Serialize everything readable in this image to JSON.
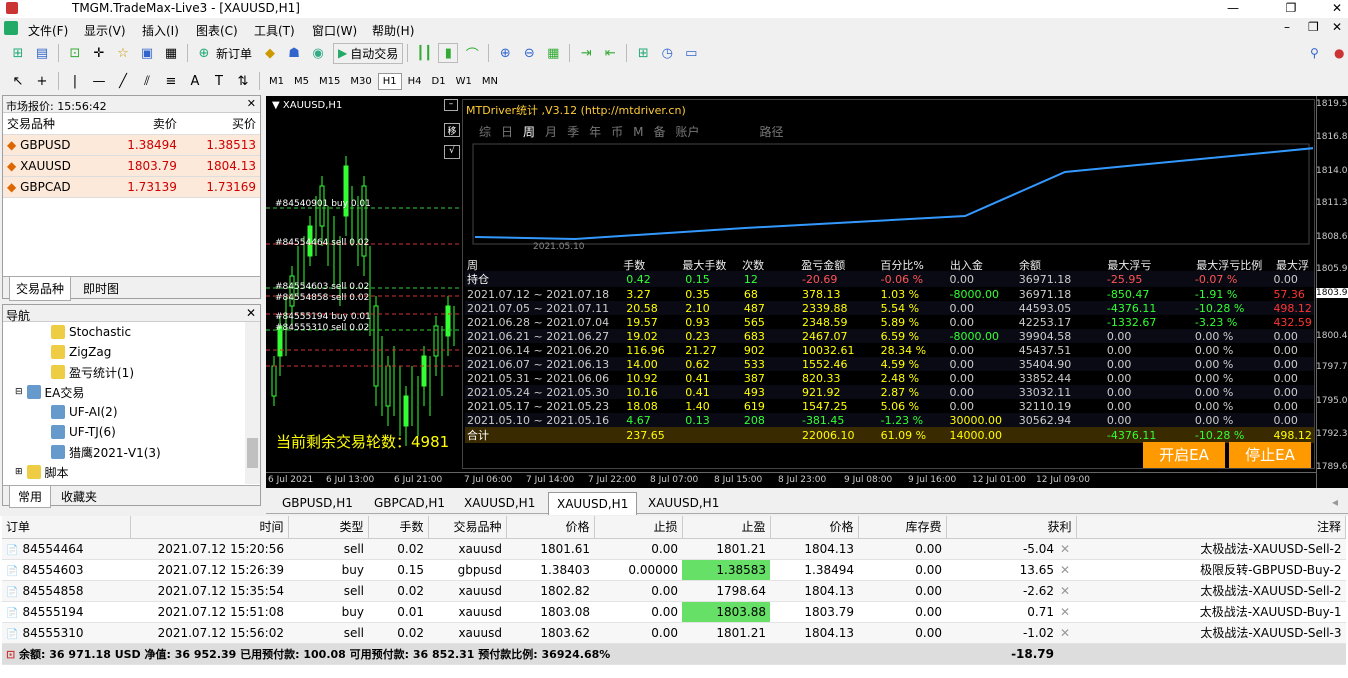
{
  "window": {
    "title": "TMGM.TradeMax-Live3 - [XAUUSD,H1]"
  },
  "menu": [
    "文件(F)",
    "显示(V)",
    "插入(I)",
    "图表(C)",
    "工具(T)",
    "窗口(W)",
    "帮助(H)"
  ],
  "toolbar": {
    "new_order": "新订单",
    "auto_trade": "自动交易",
    "timeframes": [
      "M1",
      "M5",
      "M15",
      "M30",
      "H1",
      "H4",
      "D1",
      "W1",
      "MN"
    ]
  },
  "market_watch": {
    "title": "市场报价: 15:56:42",
    "headers": [
      "交易品种",
      "卖价",
      "买价"
    ],
    "rows": [
      {
        "symbol": "GBPUSD",
        "bid": "1.38494",
        "ask": "1.38513"
      },
      {
        "symbol": "XAUUSD",
        "bid": "1803.79",
        "ask": "1804.13"
      },
      {
        "symbol": "GBPCAD",
        "bid": "1.73139",
        "ask": "1.73169"
      }
    ],
    "tabs": [
      "交易品种",
      "即时图"
    ]
  },
  "navigator": {
    "title": "导航",
    "items": [
      "Stochastic",
      "ZigZag",
      "盈亏统计(1)",
      "EA交易",
      "UF-AI(2)",
      "UF-TJ(6)",
      "猎鹰2021-V1(3)",
      "脚本"
    ],
    "tabs": [
      "常用",
      "收藏夹"
    ]
  },
  "chart": {
    "symbol": "XAUUSD,H1",
    "remaining": "当前剩余交易轮数：4981",
    "order_labels": [
      "#84540901 buy 0.01",
      "#84554464 sell 0.02",
      "#84554603 sell 0.02",
      "#84554858 sell 0.02",
      "#84555194 buy 0.01",
      "#84555310 sell 0.02"
    ],
    "prices": [
      "1819.50",
      "1816.80",
      "1814.00",
      "1811.30",
      "1808.60",
      "1805.90",
      "1803.9",
      "1800.40",
      "1797.70",
      "1795.00",
      "1792.30",
      "1789.60"
    ],
    "times": [
      "6 Jul 2021",
      "6 Jul 13:00",
      "6 Jul 21:00",
      "7 Jul 06:00",
      "7 Jul 14:00",
      "7 Jul 22:00",
      "8 Jul 07:00",
      "8 Jul 15:00",
      "8 Jul 23:00",
      "9 Jul 08:00",
      "9 Jul 16:00",
      "12 Jul 01:00",
      "12 Jul 09:00"
    ]
  },
  "stat": {
    "title": "MTDriver统计 ,V3.12 (http://mtdriver.cn)",
    "tabs": [
      "综",
      "日",
      "周",
      "月",
      "季",
      "年",
      "币",
      "M",
      "备",
      "账户",
      "路径"
    ],
    "active_tab": "周",
    "curve_date": "2021.05.10",
    "headers": [
      "周",
      "手数",
      "最大手数",
      "次数",
      "盈亏金额",
      "百分比%",
      "出入金",
      "余额",
      "最大浮亏",
      "最大浮亏比例",
      "最大浮"
    ],
    "rows": [
      [
        "持仓",
        "0.42",
        "0.15",
        "12",
        "-20.69",
        "-0.06 %",
        "0.00",
        "36971.18",
        "-25.95",
        "-0.07 %",
        "0.00"
      ],
      [
        "2021.07.12 ~ 2021.07.18",
        "3.27",
        "0.35",
        "68",
        "378.13",
        "1.03 %",
        "-8000.00",
        "36971.18",
        "-850.47",
        "-1.91 %",
        "57.36"
      ],
      [
        "2021.07.05 ~ 2021.07.11",
        "20.58",
        "2.10",
        "487",
        "2339.88",
        "5.54 %",
        "0.00",
        "44593.05",
        "-4376.11",
        "-10.28 %",
        "498.12"
      ],
      [
        "2021.06.28 ~ 2021.07.04",
        "19.57",
        "0.93",
        "565",
        "2348.59",
        "5.89 %",
        "0.00",
        "42253.17",
        "-1332.67",
        "-3.23 %",
        "432.59"
      ],
      [
        "2021.06.21 ~ 2021.06.27",
        "19.02",
        "0.23",
        "683",
        "2467.07",
        "6.59 %",
        "-8000.00",
        "39904.58",
        "0.00",
        "0.00 %",
        "0.00"
      ],
      [
        "2021.06.14 ~ 2021.06.20",
        "116.96",
        "21.27",
        "902",
        "10032.61",
        "28.34 %",
        "0.00",
        "45437.51",
        "0.00",
        "0.00 %",
        "0.00"
      ],
      [
        "2021.06.07 ~ 2021.06.13",
        "14.00",
        "0.62",
        "533",
        "1552.46",
        "4.59 %",
        "0.00",
        "35404.90",
        "0.00",
        "0.00 %",
        "0.00"
      ],
      [
        "2021.05.31 ~ 2021.06.06",
        "10.92",
        "0.41",
        "387",
        "820.33",
        "2.48 %",
        "0.00",
        "33852.44",
        "0.00",
        "0.00 %",
        "0.00"
      ],
      [
        "2021.05.24 ~ 2021.05.30",
        "10.16",
        "0.41",
        "493",
        "921.92",
        "2.87 %",
        "0.00",
        "33032.11",
        "0.00",
        "0.00 %",
        "0.00"
      ],
      [
        "2021.05.17 ~ 2021.05.23",
        "18.08",
        "1.40",
        "619",
        "1547.25",
        "5.06 %",
        "0.00",
        "32110.19",
        "0.00",
        "0.00 %",
        "0.00"
      ],
      [
        "2021.05.10 ~ 2021.05.16",
        "4.67",
        "0.13",
        "208",
        "-381.45",
        "-1.23 %",
        "30000.00",
        "30562.94",
        "0.00",
        "0.00 %",
        "0.00"
      ],
      [
        "合计",
        "237.65",
        "",
        "",
        "22006.10",
        "61.09 %",
        "14000.00",
        "",
        "-4376.11",
        "-10.28 %",
        "498.12"
      ]
    ],
    "btn_start": "开启EA",
    "btn_stop": "停止EA"
  },
  "chart_tabs": [
    "GBPUSD,H1",
    "GBPCAD,H1",
    "XAUUSD,H1",
    "XAUUSD,H1",
    "XAUUSD,H1"
  ],
  "orders": {
    "headers": [
      "订单",
      "时间",
      "类型",
      "手数",
      "交易品种",
      "价格",
      "止损",
      "止盈",
      "价格",
      "库存费",
      "获利",
      "注释"
    ],
    "rows": [
      [
        "84554464",
        "2021.07.12 15:20:56",
        "sell",
        "0.02",
        "xauusd",
        "1801.61",
        "0.00",
        "1801.21",
        "1804.13",
        "0.00",
        "-5.04",
        "太极战法-XAUUSD-Sell-2"
      ],
      [
        "84554603",
        "2021.07.12 15:26:39",
        "buy",
        "0.15",
        "gbpusd",
        "1.38403",
        "0.00000",
        "1.38583",
        "1.38494",
        "0.00",
        "13.65",
        "极限反转-GBPUSD-Buy-2"
      ],
      [
        "84554858",
        "2021.07.12 15:35:54",
        "sell",
        "0.02",
        "xauusd",
        "1802.82",
        "0.00",
        "1798.64",
        "1804.13",
        "0.00",
        "-2.62",
        "太极战法-XAUUSD-Sell-2"
      ],
      [
        "84555194",
        "2021.07.12 15:51:08",
        "buy",
        "0.01",
        "xauusd",
        "1803.08",
        "0.00",
        "1803.88",
        "1803.79",
        "0.00",
        "0.71",
        "太极战法-XAUUSD-Buy-1"
      ],
      [
        "84555310",
        "2021.07.12 15:56:02",
        "sell",
        "0.02",
        "xauusd",
        "1803.62",
        "0.00",
        "1801.21",
        "1804.13",
        "0.00",
        "-1.02",
        "太极战法-XAUUSD-Sell-3"
      ]
    ],
    "summary": "余额: 36 971.18 USD  净值: 36 952.39  已用预付款: 100.08  可用预付款: 36 852.31  预付款比例: 36924.68%",
    "total": "-18.79"
  }
}
